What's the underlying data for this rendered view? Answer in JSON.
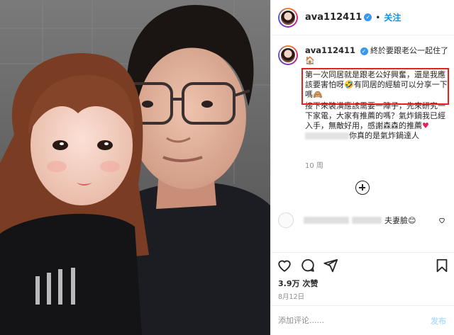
{
  "header": {
    "username": "ava112411",
    "verified_mark": "✓",
    "separator": "•",
    "follow_label": "关注"
  },
  "post": {
    "caption_user": "ava112411",
    "caption_title": "終於要跟老公一起住了",
    "caption_title_emoji": "🏠",
    "highlight_line1": "第一次同居就是跟老公好興奮，還是我應該要害怕呀",
    "highlight_emoji1": "🤣",
    "highlight_line2": "有同居的經驗可以分享一下嗎",
    "highlight_emoji2": "🙈",
    "rest_part1": "接下來裝潢應該需要一陣子，先來研究一下家電，大家有推薦的嗎？氣炸鍋我已經入手，無敵好用，感謝森森的推薦",
    "rest_heart": "♥",
    "rest_part2": "你真的是氣炸鍋達人",
    "caption_time": "10 周"
  },
  "comment": {
    "text": "夫妻臉",
    "emoji": "😊"
  },
  "stats": {
    "likes": "3.9万 次赞",
    "date": "8月12日"
  },
  "comment_box": {
    "placeholder": "添加评论......",
    "post_label": "发布"
  },
  "colors": {
    "follow": "#0095f6",
    "highlight_box": "#e5201f",
    "post_disabled": "#b2dffc"
  },
  "icons": [
    "heart-icon",
    "comment-icon",
    "share-icon",
    "bookmark-icon",
    "load-more-icon"
  ]
}
